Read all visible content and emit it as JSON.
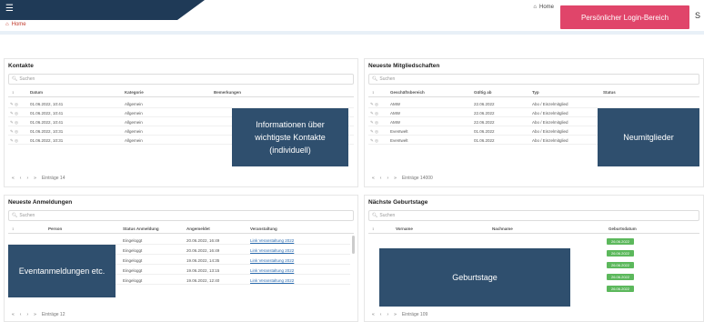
{
  "header": {
    "menu_icon": "menu-icon",
    "home_label": "Home",
    "portal_button": "Persönlicher Login-Bereich",
    "extra_icon": "S"
  },
  "breadcrumb": {
    "label": "Home"
  },
  "panels": {
    "kontakte": {
      "title": "Kontakte",
      "search_placeholder": "Suchen",
      "columns": [
        "Datum",
        "Kategorie",
        "Bemerkungen"
      ],
      "rows": [
        [
          "01.06.2022, 10:41",
          "Allgemein"
        ],
        [
          "01.06.2022, 10:41",
          "Allgemein"
        ],
        [
          "01.06.2022, 10:41",
          "Allgemein"
        ],
        [
          "01.06.2022, 10:31",
          "Allgemein"
        ],
        [
          "01.06.2022, 10:31",
          "Allgemein"
        ]
      ],
      "pager_text": "Einträge 14",
      "overlay": "Informationen über wichtigste Kontakte (individuell)"
    },
    "mitglieder": {
      "title": "Neueste Mitgliedschaften",
      "search_placeholder": "Suchen",
      "columns": [
        "Geschäftsbereich",
        "Gültig ab",
        "Typ",
        "Status"
      ],
      "rows": [
        [
          "AMW",
          "22.06.2022",
          "Abo / Einzelmitglied"
        ],
        [
          "AMW",
          "22.06.2022",
          "Abo / Einzelmitglied"
        ],
        [
          "AMW",
          "22.06.2022",
          "Abo / Einzelmitglied"
        ],
        [
          "Eventwelt",
          "01.06.2022",
          "Abo / Einzelmitglied"
        ],
        [
          "Eventwelt",
          "01.06.2022",
          "Abo / Einzelmitglied"
        ]
      ],
      "pager_text": "Einträge 14000",
      "overlay": "Neumitglieder"
    },
    "anmeldungen": {
      "title": "Neueste Anmeldungen",
      "search_placeholder": "Suchen",
      "columns": [
        "Person",
        "Status Anmeldung",
        "Angemeldet",
        "Veranstaltung"
      ],
      "rows": [
        [
          "Eingeloggt",
          "20.06.2022, 16:49",
          "Link Veranstaltung 2022"
        ],
        [
          "Eingeloggt",
          "20.06.2022, 16:49",
          "Link Veranstaltung 2022"
        ],
        [
          "Eingeloggt",
          "19.06.2022, 14:35",
          "Link Veranstaltung 2022"
        ],
        [
          "Eingeloggt",
          "19.06.2022, 13:15",
          "Link Veranstaltung 2022"
        ],
        [
          "Eingeloggt",
          "19.06.2022, 12:40",
          "Link Veranstaltung 2022"
        ]
      ],
      "pager_text": "Einträge 12",
      "overlay": "Eventanmeldungen etc."
    },
    "geburtstage": {
      "title": "Nächste Geburtstage",
      "search_placeholder": "Suchen",
      "columns": [
        "Vorname",
        "Nachname",
        "Geburtsdatum"
      ],
      "badges": [
        "26.06.2022",
        "26.06.2022",
        "26.06.2022",
        "26.06.2022",
        "26.06.2022"
      ],
      "pager_text": "Einträge 109",
      "overlay": "Geburtstage"
    }
  },
  "colors": {
    "accent": "#e0456a",
    "overlay": "#2f4f6e",
    "header_dark": "#1f3a57",
    "badge": "#5cb85c"
  }
}
